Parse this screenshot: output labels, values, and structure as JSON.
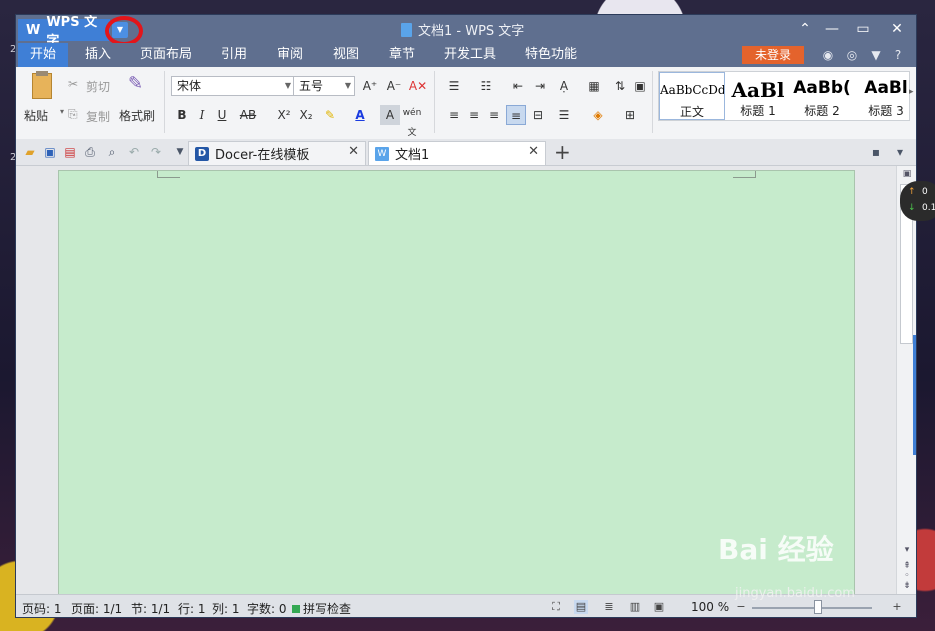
{
  "app": {
    "name": "WPS 文字",
    "window_title": "文档1 - WPS 文字",
    "login_label": "未登录"
  },
  "menu_tabs": [
    "开始",
    "插入",
    "页面布局",
    "引用",
    "审阅",
    "视图",
    "章节",
    "开发工具",
    "特色功能"
  ],
  "ribbon": {
    "paste": "粘贴",
    "cut": "剪切",
    "copy": "复制",
    "format_painter": "格式刷",
    "font_name": "宋体",
    "font_size": "五号",
    "styles": [
      {
        "preview": "AaBbCcDd",
        "name": "正文"
      },
      {
        "preview": "AaBl",
        "name": "标题 1"
      },
      {
        "preview": "AaBb(",
        "name": "标题 2"
      },
      {
        "preview": "AaBl",
        "name": "标题 3"
      }
    ]
  },
  "tabs": [
    {
      "label": "Docer-在线模板",
      "active": false
    },
    {
      "label": "文档1",
      "active": true
    }
  ],
  "status": {
    "page_num": "页码: 1",
    "pages": "页面: 1/1",
    "section": "节: 1/1",
    "row": "行: 1",
    "col": "列: 1",
    "word_count": "字数: 0",
    "spell_check": "拼写检查",
    "zoom": "100 %"
  },
  "widget": {
    "up": "0",
    "down": "0.1"
  },
  "watermark": {
    "brand": "Bai 经验",
    "url": "jingyan.baidu.com"
  },
  "colors": {
    "accent": "#3f7fd6",
    "titlebar": "#5f6f8f",
    "page": "#c6ebcc",
    "login": "#e4632c"
  }
}
